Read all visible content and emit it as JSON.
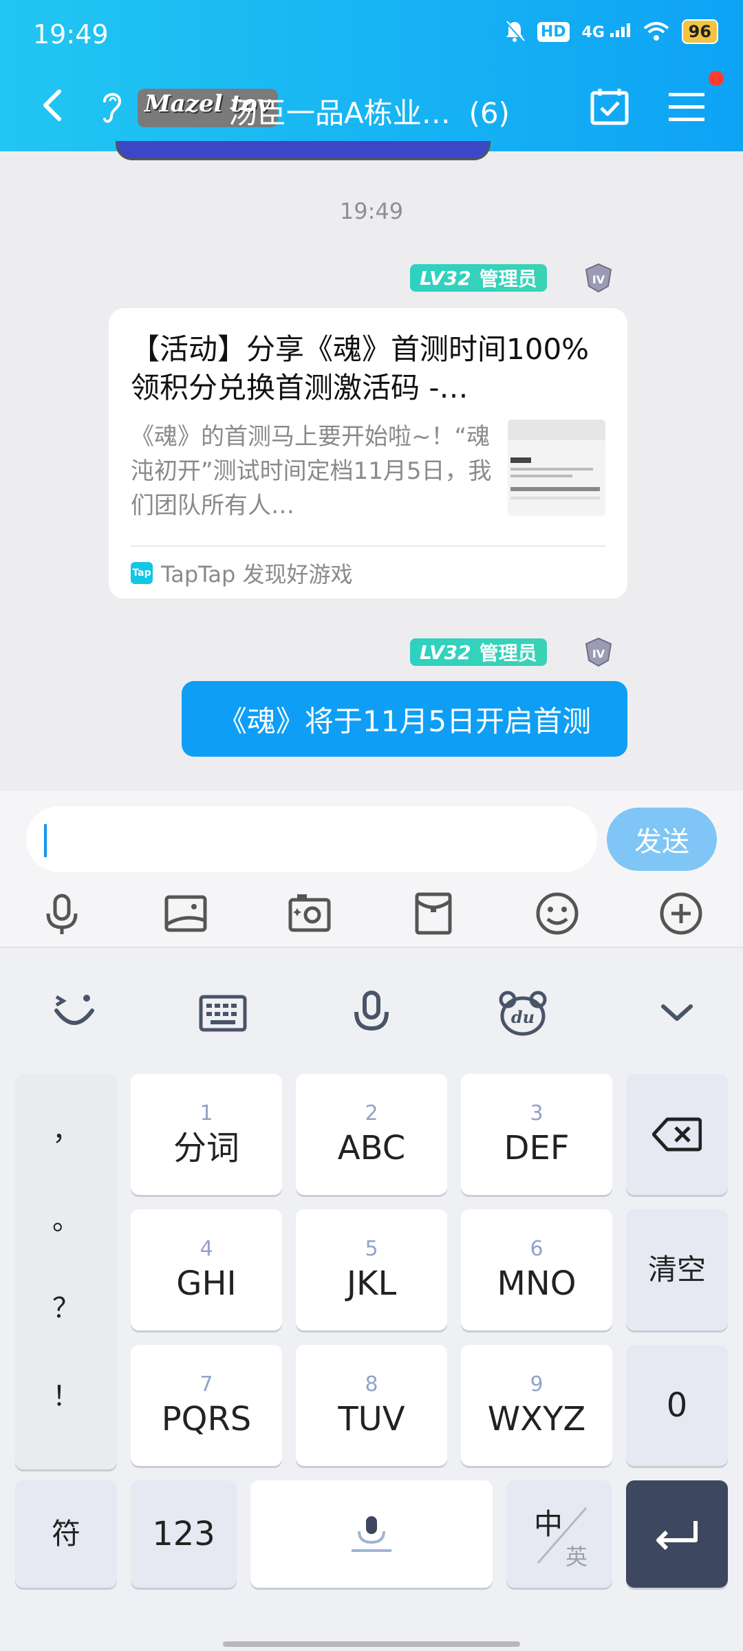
{
  "status_bar": {
    "time": "19:49",
    "hd": "HD",
    "network": "4G",
    "battery": "96"
  },
  "nav": {
    "logo_text": "Mazel tov",
    "title": "汤臣一品A栋业…",
    "member_count": "(6)"
  },
  "chat": {
    "timestamp": "19:49",
    "messages": [
      {
        "badge_level": "LV32",
        "badge_role": "管理员",
        "card": {
          "title": "【活动】分享《魂》首测时间100%领积分兑换首测激活码 -…",
          "description": "《魂》的首测马上要开始啦~！“魂沌初开”测试时间定档11月5日，我们团队所有人…",
          "source_icon": "Tap",
          "source": "TapTap 发现好游戏"
        }
      },
      {
        "badge_level": "LV32",
        "badge_role": "管理员",
        "text": "《魂》将于11月5日开启首测"
      }
    ]
  },
  "composer": {
    "placeholder": "",
    "send_label": "发送"
  },
  "keyboard": {
    "punctuation": [
      "，",
      "。",
      "？",
      "！"
    ],
    "keys": [
      {
        "num": "1",
        "label": "分词"
      },
      {
        "num": "2",
        "label": "ABC"
      },
      {
        "num": "3",
        "label": "DEF"
      },
      {
        "num": "4",
        "label": "GHI"
      },
      {
        "num": "5",
        "label": "JKL"
      },
      {
        "num": "6",
        "label": "MNO"
      },
      {
        "num": "7",
        "label": "PQRS"
      },
      {
        "num": "8",
        "label": "TUV"
      },
      {
        "num": "9",
        "label": "WXYZ"
      }
    ],
    "clear_label": "清空",
    "zero_label": "0",
    "symbols_label": "符",
    "numbers_label": "123",
    "lang_main": "中",
    "lang_alt": "英"
  },
  "colors": {
    "header_start": "#22c6f2",
    "header_end": "#0ea3f5",
    "bubble": "#0f9ef5",
    "send": "#7fc6f6",
    "badge": "#2ed1c1"
  }
}
